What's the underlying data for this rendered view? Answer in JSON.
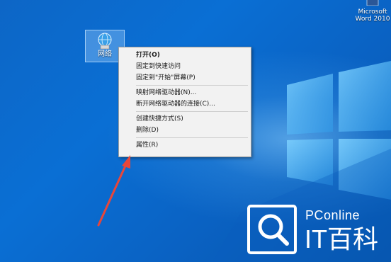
{
  "desktop": {
    "network_icon": {
      "label": "网络",
      "icon": "network-icon"
    },
    "word_shortcut": {
      "line1": "Microsoft",
      "line2": "Word 2010",
      "icon": "word-document-icon"
    }
  },
  "context_menu": {
    "groups": [
      {
        "items": [
          {
            "label": "打开(O)",
            "bold": true
          },
          {
            "label": "固定到快速访问",
            "bold": false
          },
          {
            "label": "固定到\"开始\"屏幕(P)",
            "bold": false
          }
        ]
      },
      {
        "items": [
          {
            "label": "映射网络驱动器(N)...",
            "bold": false
          },
          {
            "label": "断开网络驱动器的连接(C)...",
            "bold": false
          }
        ]
      },
      {
        "items": [
          {
            "label": "创建快捷方式(S)",
            "bold": false
          },
          {
            "label": "删除(D)",
            "bold": false
          }
        ]
      },
      {
        "items": [
          {
            "label": "属性(R)",
            "bold": false
          }
        ]
      }
    ]
  },
  "annotation": {
    "arrow_color": "#e8463a"
  },
  "watermark": {
    "brand": "PConline",
    "name": "IT百科",
    "icon": "search-magnifier-logo"
  },
  "colors": {
    "desktop_blue": "#0a6fd4",
    "menu_bg": "#f2f2f2"
  }
}
